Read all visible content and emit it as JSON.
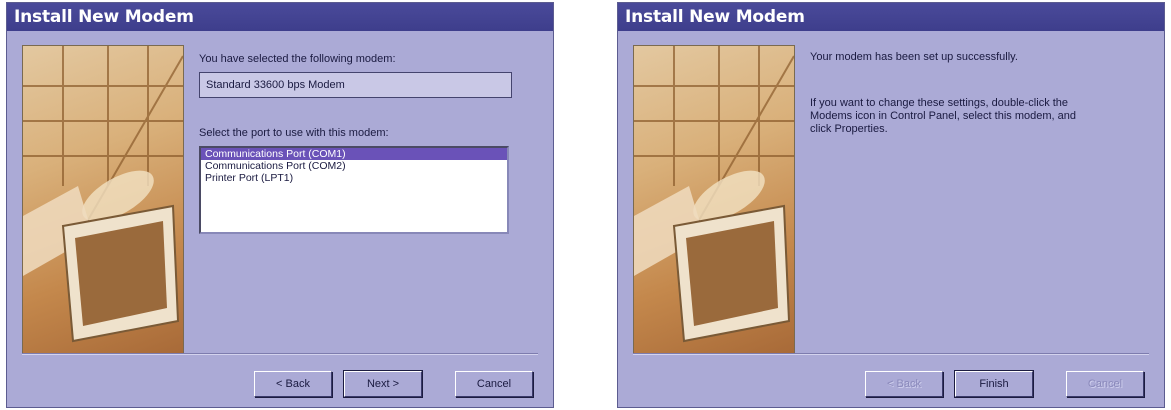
{
  "dialog1": {
    "title": "Install New Modem",
    "selected_label": "You have selected the following modem:",
    "modem_name": "Standard 33600 bps Modem",
    "port_label": "Select the port to use with this modem:",
    "ports": [
      {
        "label": "Communications Port (COM1)",
        "selected": true
      },
      {
        "label": "Communications Port (COM2)",
        "selected": false
      },
      {
        "label": "Printer Port (LPT1)",
        "selected": false
      }
    ],
    "buttons": {
      "back": "< Back",
      "next": "Next >",
      "cancel": "Cancel"
    }
  },
  "dialog2": {
    "title": "Install New Modem",
    "success_text": "Your modem has been set up successfully.",
    "info_text": "If you want to change these settings, double-click the Modems icon in Control Panel, select this modem, and click Properties.",
    "buttons": {
      "back": "< Back",
      "finish": "Finish",
      "cancel": "Cancel"
    }
  },
  "colors": {
    "title_bar": "#3e3e8c",
    "dialog_bg": "#abaad6",
    "selection": "#6a52b8"
  },
  "icons": [
    "wizard-illustration"
  ]
}
